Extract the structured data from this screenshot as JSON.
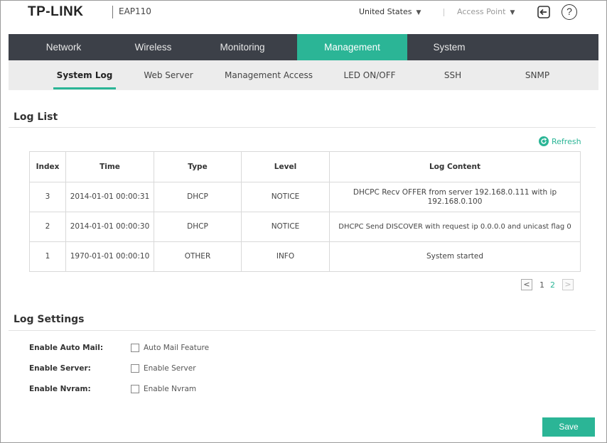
{
  "header": {
    "logo": "TP-LINK",
    "model": "EAP110",
    "region": "United States",
    "mode": "Access Point"
  },
  "main_nav": [
    {
      "label": "Network",
      "active": false
    },
    {
      "label": "Wireless",
      "active": false
    },
    {
      "label": "Monitoring",
      "active": false
    },
    {
      "label": "Management",
      "active": true
    },
    {
      "label": "System",
      "active": false
    }
  ],
  "sub_nav": [
    {
      "label": "System Log",
      "active": true
    },
    {
      "label": "Web Server",
      "active": false
    },
    {
      "label": "Management Access",
      "active": false
    },
    {
      "label": "LED ON/OFF",
      "active": false
    },
    {
      "label": "SSH",
      "active": false
    },
    {
      "label": "SNMP",
      "active": false
    }
  ],
  "log_list": {
    "title": "Log List",
    "refresh_label": "Refresh",
    "columns": [
      "Index",
      "Time",
      "Type",
      "Level",
      "Log Content"
    ],
    "rows": [
      {
        "index": "3",
        "time": "2014-01-01 00:00:31",
        "type": "DHCP",
        "level": "NOTICE",
        "content": "DHCPC Recv OFFER from server 192.168.0.111 with ip 192.168.0.100"
      },
      {
        "index": "2",
        "time": "2014-01-01 00:00:30",
        "type": "DHCP",
        "level": "NOTICE",
        "content": "DHCPC Send DISCOVER with request ip 0.0.0.0 and unicast flag 0"
      },
      {
        "index": "1",
        "time": "1970-01-01 00:00:10",
        "type": "OTHER",
        "level": "INFO",
        "content": "System started"
      }
    ],
    "pagination": {
      "prev": "<",
      "next": ">",
      "pages": [
        "1",
        "2"
      ],
      "current": "2"
    }
  },
  "log_settings": {
    "title": "Log Settings",
    "items": [
      {
        "label": "Enable Auto Mail:",
        "checkbox_label": "Auto Mail Feature",
        "checked": false
      },
      {
        "label": "Enable Server:",
        "checkbox_label": "Enable Server",
        "checked": false
      },
      {
        "label": "Enable Nvram:",
        "checkbox_label": "Enable Nvram",
        "checked": false
      }
    ]
  },
  "save_label": "Save",
  "colors": {
    "accent": "#2bb596",
    "nav_bg": "#3c4048",
    "subnav_bg": "#ececec"
  },
  "icons": {
    "logout": "logout-icon",
    "help": "help-icon",
    "refresh": "refresh-icon"
  }
}
